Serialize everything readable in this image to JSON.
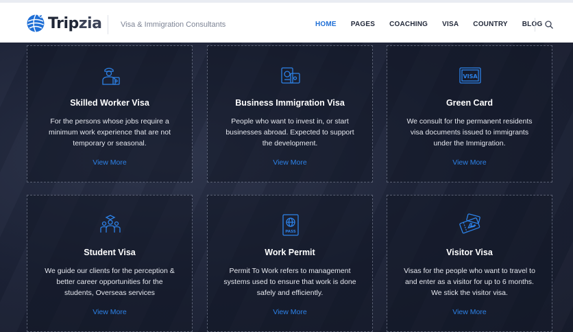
{
  "brand": {
    "name_part1": "Trip",
    "name_part2": "zia",
    "tagline": "Visa & Immigration Consultants"
  },
  "nav": {
    "items": [
      {
        "label": "HOME",
        "active": true
      },
      {
        "label": "PAGES",
        "active": false
      },
      {
        "label": "COACHING",
        "active": false
      },
      {
        "label": "VISA",
        "active": false
      },
      {
        "label": "COUNTRY",
        "active": false
      },
      {
        "label": "BLOG",
        "active": false
      }
    ],
    "search_icon": "search-icon"
  },
  "colors": {
    "accent": "#1f6fd6",
    "link": "#2d82e8",
    "background": "#1c2236"
  },
  "services": [
    {
      "icon": "worker-icon",
      "title": "Skilled Worker Visa",
      "desc": "For the persons whose jobs require a minimum work experience that are not temporary or seasonal.",
      "link": "View More"
    },
    {
      "icon": "business-passport-icon",
      "title": "Business Immigration Visa",
      "desc": "People who want to invest in, or start businesses abroad. Expected to support the development.",
      "link": "View More"
    },
    {
      "icon": "visa-card-icon",
      "title": "Green Card",
      "desc": "We consult for the permanent residents visa documents issued to immigrants under the Immigration.",
      "link": "View More"
    },
    {
      "icon": "students-icon",
      "title": "Student Visa",
      "desc": "We guide our clients for the perception & better career opportunities for the students, Overseas services",
      "link": "View More"
    },
    {
      "icon": "passport-icon",
      "title": "Work Permit",
      "desc": "Permit To Work refers to management systems used to ensure that work is done safely and efficiently.",
      "link": "View More"
    },
    {
      "icon": "tickets-icon",
      "title": "Visitor Visa",
      "desc": "Visas for the people who want to travel to and enter as a visitor for up to 6 months. We stick the visitor visa.",
      "link": "View More"
    }
  ]
}
